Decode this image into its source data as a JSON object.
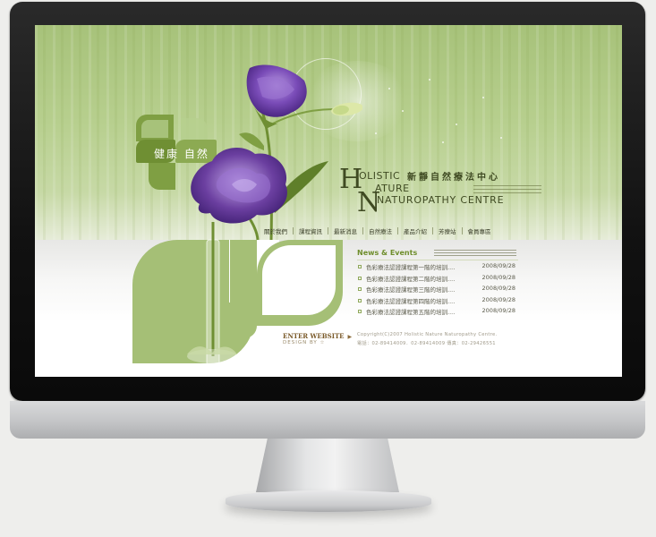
{
  "brand": {
    "badge_text": "健康 自然",
    "logo_h": "H",
    "logo_n": "N",
    "logo_line1": "OLISTIC",
    "logo_chinese": "新靜自然療法中心",
    "logo_line2": "ATURE",
    "logo_line3": "NATUROPATHY CENTRE"
  },
  "nav": {
    "items": [
      "關於我們",
      "課程資訊",
      "最新消息",
      "自然療法",
      "產品介紹",
      "芳療站",
      "會員專區"
    ]
  },
  "enter": {
    "label": "ENTER WEBSITE",
    "arrow": "▶",
    "design_by": "DESIGN BY ☆"
  },
  "news": {
    "title": "News & Events",
    "items": [
      {
        "text": "色彩療法認證課程第一階的培訓....",
        "date": "2008/09/28"
      },
      {
        "text": "色彩療法認證課程第二階的培訓....",
        "date": "2008/09/28"
      },
      {
        "text": "色彩療法認證課程第三階的培訓....",
        "date": "2008/09/28"
      },
      {
        "text": "色彩療法認證課程第四階的培訓....",
        "date": "2008/09/28"
      },
      {
        "text": "色彩療法認證課程第五階的培訓....",
        "date": "2008/09/28"
      }
    ]
  },
  "footer": {
    "copyright": "Copyright(C)2007 Holistic Nature Naturopathy Centre.",
    "contact": "電話：02-89414009．02-89414009  傳真：02-29426551"
  },
  "colors": {
    "banner_green": "#b7cf8e",
    "accent_green": "#a5bf76",
    "flower_purple": "#6b3fa0",
    "logo_dark": "#3f4a22"
  }
}
